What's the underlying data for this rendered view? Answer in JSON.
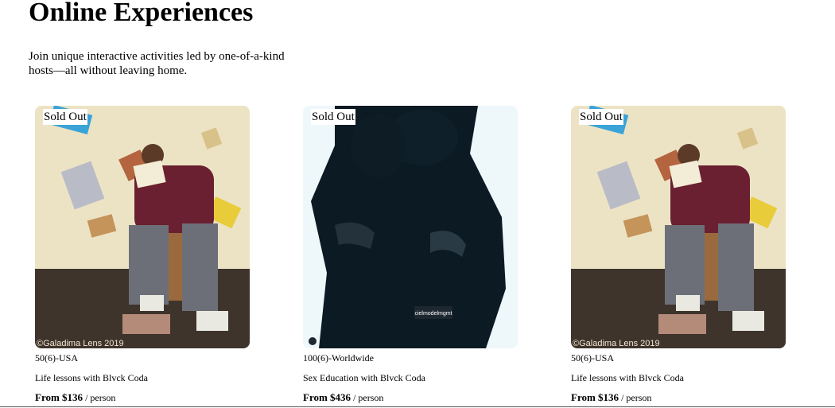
{
  "page": {
    "title": "Online Experiences",
    "subtitle": "Join unique interactive activities led by one-of-a-kind hosts—all without leaving home."
  },
  "cards": [
    {
      "badge": "Sold Out",
      "meta": "50(6)-USA",
      "name": "Life lessons with Blvck Coda",
      "price": "From $136",
      "unit": "/ person",
      "watermark": "©Galadima Lens 2019"
    },
    {
      "badge": "Sold Out",
      "meta": "100(6)-Worldwide",
      "name": "Sex Education with Blvck Coda",
      "price": "From $436",
      "unit": "/ person",
      "watermark": "cielmodelmgmt"
    },
    {
      "badge": "Sold Out",
      "meta": "50(6)-USA",
      "name": "Life lessons with Blvck Coda",
      "price": "From $136",
      "unit": "/ person",
      "watermark": "©Galadima Lens 2019"
    }
  ]
}
